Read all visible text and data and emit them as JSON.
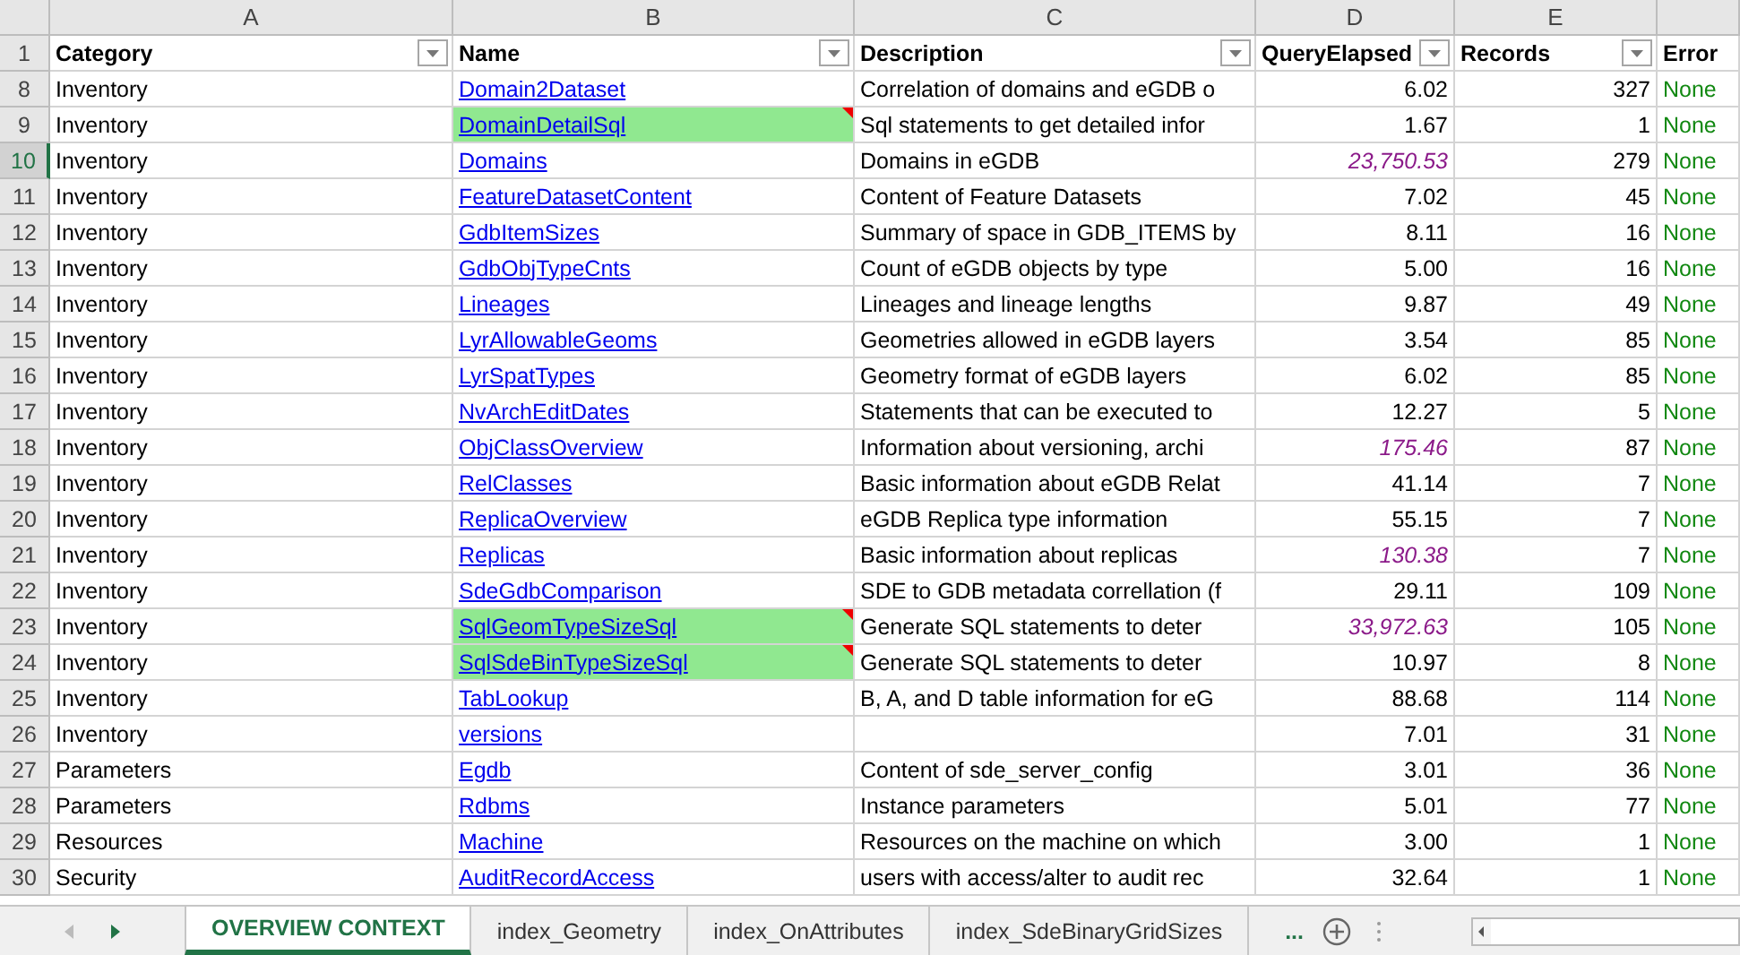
{
  "columns": [
    "A",
    "B",
    "C",
    "D",
    "E"
  ],
  "header": {
    "row": "1",
    "cells": [
      {
        "label": "Category",
        "filter": true
      },
      {
        "label": "Name",
        "filter": true
      },
      {
        "label": "Description",
        "filter": true
      },
      {
        "label": "QueryElapsed",
        "filter": true
      },
      {
        "label": "Records",
        "filter": true
      },
      {
        "label": "Error",
        "filter": false
      }
    ]
  },
  "rows": [
    {
      "row": "8",
      "category": "Inventory",
      "name": "Domain2Dataset",
      "highlighted": false,
      "description": "Correlation of domains and eGDB o",
      "elapsed": "6.02",
      "slow": false,
      "records": "327",
      "error": "None",
      "selected": false
    },
    {
      "row": "9",
      "category": "Inventory",
      "name": "DomainDetailSql",
      "highlighted": true,
      "description": "Sql statements to get detailed infor",
      "elapsed": "1.67",
      "slow": false,
      "records": "1",
      "error": "None",
      "selected": false
    },
    {
      "row": "10",
      "category": "Inventory",
      "name": "Domains",
      "highlighted": false,
      "description": "Domains in eGDB",
      "elapsed": "23,750.53",
      "slow": true,
      "records": "279",
      "error": "None",
      "selected": true
    },
    {
      "row": "11",
      "category": "Inventory",
      "name": "FeatureDatasetContent",
      "highlighted": false,
      "description": "Content of Feature Datasets",
      "elapsed": "7.02",
      "slow": false,
      "records": "45",
      "error": "None",
      "selected": false
    },
    {
      "row": "12",
      "category": "Inventory",
      "name": "GdbItemSizes",
      "highlighted": false,
      "description": "Summary of space in GDB_ITEMS by",
      "elapsed": "8.11",
      "slow": false,
      "records": "16",
      "error": "None",
      "selected": false
    },
    {
      "row": "13",
      "category": "Inventory",
      "name": "GdbObjTypeCnts",
      "highlighted": false,
      "description": "Count of eGDB objects by type",
      "elapsed": "5.00",
      "slow": false,
      "records": "16",
      "error": "None",
      "selected": false
    },
    {
      "row": "14",
      "category": "Inventory",
      "name": "Lineages",
      "highlighted": false,
      "description": "Lineages and lineage lengths",
      "elapsed": "9.87",
      "slow": false,
      "records": "49",
      "error": "None",
      "selected": false
    },
    {
      "row": "15",
      "category": "Inventory",
      "name": "LyrAllowableGeoms",
      "highlighted": false,
      "description": "Geometries allowed in eGDB layers",
      "elapsed": "3.54",
      "slow": false,
      "records": "85",
      "error": "None",
      "selected": false
    },
    {
      "row": "16",
      "category": "Inventory",
      "name": "LyrSpatTypes",
      "highlighted": false,
      "description": "Geometry format of eGDB layers",
      "elapsed": "6.02",
      "slow": false,
      "records": "85",
      "error": "None",
      "selected": false
    },
    {
      "row": "17",
      "category": "Inventory",
      "name": "NvArchEditDates",
      "highlighted": false,
      "description": "Statements that can be executed to",
      "elapsed": "12.27",
      "slow": false,
      "records": "5",
      "error": "None",
      "selected": false
    },
    {
      "row": "18",
      "category": "Inventory",
      "name": "ObjClassOverview",
      "highlighted": false,
      "description": "Information about versioning, archi",
      "elapsed": "175.46",
      "slow": true,
      "records": "87",
      "error": "None",
      "selected": false
    },
    {
      "row": "19",
      "category": "Inventory",
      "name": "RelClasses",
      "highlighted": false,
      "description": "Basic information about eGDB Relat",
      "elapsed": "41.14",
      "slow": false,
      "records": "7",
      "error": "None",
      "selected": false
    },
    {
      "row": "20",
      "category": "Inventory",
      "name": "ReplicaOverview",
      "highlighted": false,
      "description": "eGDB Replica type information",
      "elapsed": "55.15",
      "slow": false,
      "records": "7",
      "error": "None",
      "selected": false
    },
    {
      "row": "21",
      "category": "Inventory",
      "name": "Replicas",
      "highlighted": false,
      "description": "Basic information about replicas",
      "elapsed": "130.38",
      "slow": true,
      "records": "7",
      "error": "None",
      "selected": false
    },
    {
      "row": "22",
      "category": "Inventory",
      "name": "SdeGdbComparison",
      "highlighted": false,
      "description": "SDE to GDB metadata correllation (f",
      "elapsed": "29.11",
      "slow": false,
      "records": "109",
      "error": "None",
      "selected": false
    },
    {
      "row": "23",
      "category": "Inventory",
      "name": "SqlGeomTypeSizeSql",
      "highlighted": true,
      "description": "Generate SQL statements to deter",
      "elapsed": "33,972.63",
      "slow": true,
      "records": "105",
      "error": "None",
      "selected": false
    },
    {
      "row": "24",
      "category": "Inventory",
      "name": "SqlSdeBinTypeSizeSql",
      "highlighted": true,
      "description": "Generate SQL statements to deter",
      "elapsed": "10.97",
      "slow": false,
      "records": "8",
      "error": "None",
      "selected": false
    },
    {
      "row": "25",
      "category": "Inventory",
      "name": "TabLookup",
      "highlighted": false,
      "description": "B, A, and D table information for eG",
      "elapsed": "88.68",
      "slow": false,
      "records": "114",
      "error": "None",
      "selected": false
    },
    {
      "row": "26",
      "category": "Inventory",
      "name": "versions",
      "highlighted": false,
      "elapsed": "7.01",
      "slow": false,
      "records": "31",
      "error": "None",
      "selected": false
    },
    {
      "row": "27",
      "category": "Parameters",
      "name": "Egdb",
      "highlighted": false,
      "description": "Content of sde_server_config",
      "elapsed": "3.01",
      "slow": false,
      "records": "36",
      "error": "None",
      "selected": false
    },
    {
      "row": "28",
      "category": "Parameters",
      "name": "Rdbms",
      "highlighted": false,
      "description": "Instance parameters",
      "elapsed": "5.01",
      "slow": false,
      "records": "77",
      "error": "None",
      "selected": false
    },
    {
      "row": "29",
      "category": "Resources",
      "name": "Machine",
      "highlighted": false,
      "description": "Resources on the machine on which",
      "elapsed": "3.00",
      "slow": false,
      "records": "1",
      "error": "None",
      "selected": false
    },
    {
      "row": "30",
      "category": "Security",
      "name": "AuditRecordAccess",
      "highlighted": false,
      "description": "users with access/alter to audit rec",
      "elapsed": "32.64",
      "slow": false,
      "records": "1",
      "error": "None",
      "selected": false
    }
  ],
  "sheet_tabs": {
    "tabs": [
      {
        "label": "OVERVIEW CONTEXT",
        "selected": true
      },
      {
        "label": "index_Geometry",
        "selected": false
      },
      {
        "label": "index_OnAttributes",
        "selected": false
      },
      {
        "label": "index_SdeBinaryGridSizes",
        "selected": false
      }
    ],
    "more": "..."
  }
}
